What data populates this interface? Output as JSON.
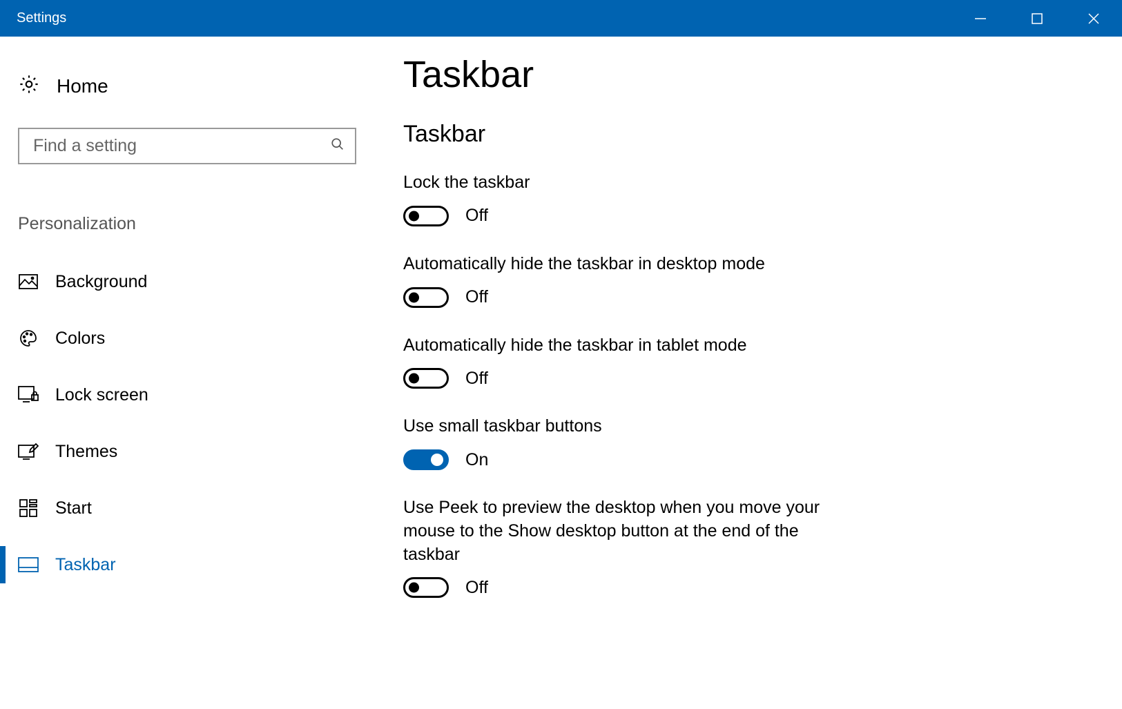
{
  "window": {
    "title": "Settings"
  },
  "sidebar": {
    "home": "Home",
    "search_placeholder": "Find a setting",
    "category": "Personalization",
    "items": [
      {
        "label": "Background"
      },
      {
        "label": "Colors"
      },
      {
        "label": "Lock screen"
      },
      {
        "label": "Themes"
      },
      {
        "label": "Start"
      },
      {
        "label": "Taskbar",
        "active": true
      }
    ]
  },
  "main": {
    "page_title": "Taskbar",
    "section_title": "Taskbar",
    "on_label": "On",
    "off_label": "Off",
    "options": [
      {
        "label": "Lock the taskbar",
        "on": false
      },
      {
        "label": "Automatically hide the taskbar in desktop mode",
        "on": false
      },
      {
        "label": "Automatically hide the taskbar in tablet mode",
        "on": false
      },
      {
        "label": "Use small taskbar buttons",
        "on": true
      },
      {
        "label": "Use Peek to preview the desktop when you move your mouse to the Show desktop button at the end of the taskbar",
        "on": false
      }
    ]
  },
  "colors": {
    "accent": "#0063B1"
  }
}
